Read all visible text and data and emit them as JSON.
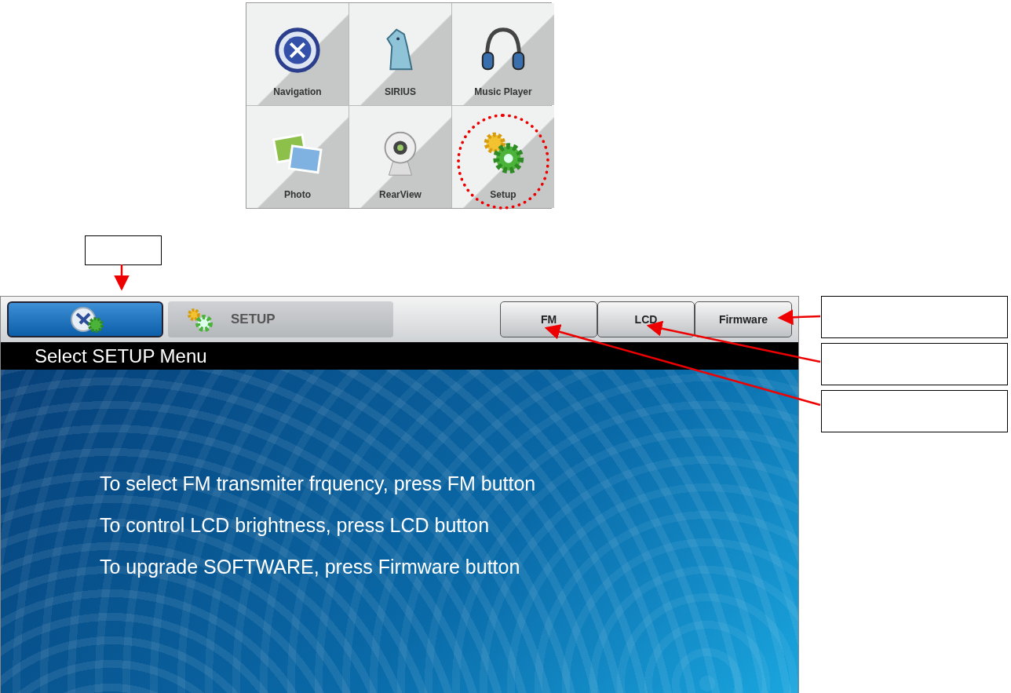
{
  "main_menu": {
    "tiles": [
      {
        "label": "Navigation",
        "kind": "navigation",
        "circled": false
      },
      {
        "label": "SIRIUS",
        "kind": "sirius",
        "circled": false
      },
      {
        "label": "Music Player",
        "kind": "music",
        "circled": false
      },
      {
        "label": "Photo",
        "kind": "photo",
        "circled": false
      },
      {
        "label": "RearView",
        "kind": "rearview",
        "circled": false
      },
      {
        "label": "Setup",
        "kind": "setup",
        "circled": true
      }
    ]
  },
  "setup_screen": {
    "tab": {
      "label": "SETUP"
    },
    "buttons": [
      {
        "label": "FM"
      },
      {
        "label": "LCD"
      },
      {
        "label": "Firmware"
      }
    ],
    "title": "Select SETUP Menu",
    "instructions": [
      "To select FM transmiter frquency, press FM button",
      "To control LCD brightness, press LCD button",
      "To upgrade SOFTWARE, press Firmware button"
    ]
  }
}
